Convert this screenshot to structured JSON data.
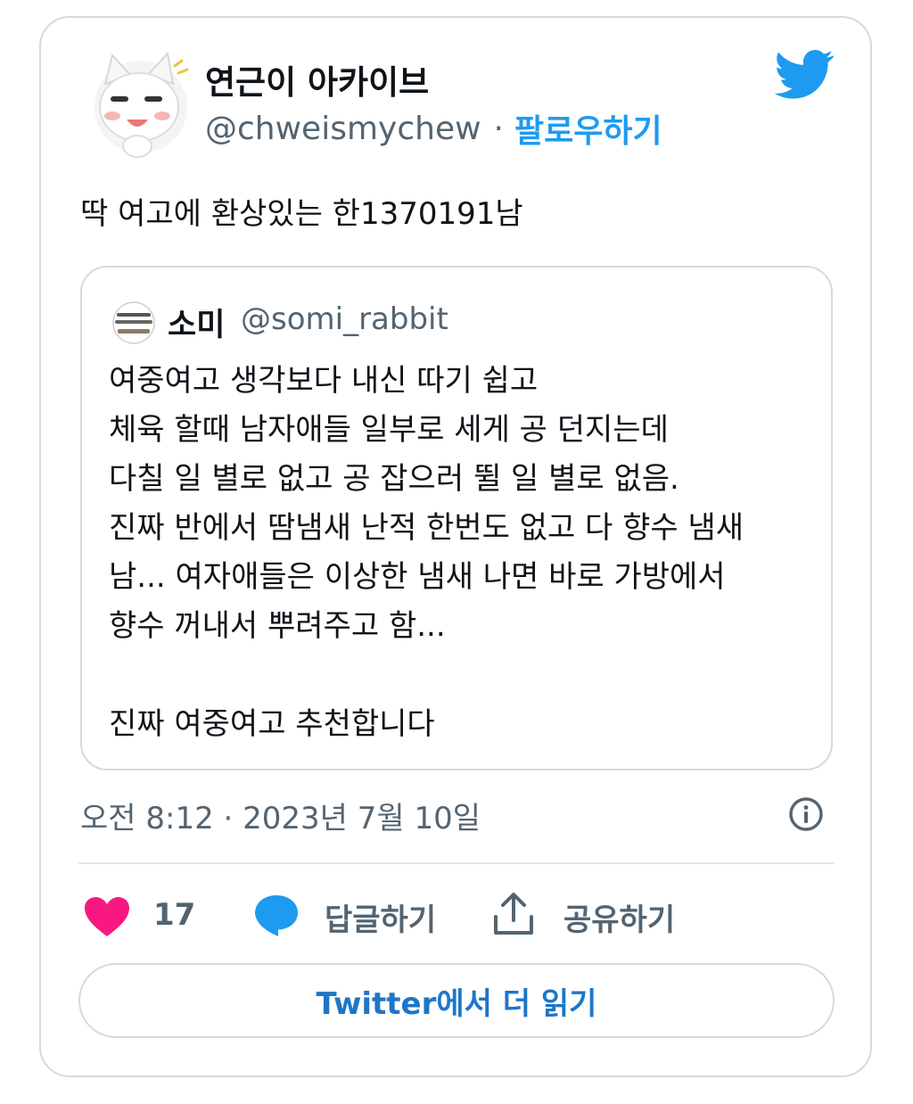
{
  "author": {
    "display_name": "연근이 아카이브",
    "handle": "@chweismychew",
    "separator": "·",
    "follow_label": "팔로우하기",
    "avatar_icon": "white-cat-avatar"
  },
  "brand": {
    "icon": "twitter-bird-icon",
    "color": "#1d9bf0"
  },
  "tweet": {
    "text": "딱 여고에 환상있는 한1370191남"
  },
  "quoted_tweet": {
    "display_name": "소미",
    "handle": "@somi_rabbit",
    "avatar_icon": "text-sign-avatar",
    "body": "여중여고 생각보다 내신 따기 쉽고\n체육 할때 남자애들 일부로 세게 공 던지는데\n다칠 일 별로 없고 공 잡으러 뛸 일 별로 없음.\n진짜 반에서 땀냄새 난적 한번도 없고 다 향수 냄새\n남... 여자애들은 이상한 냄새 나면 바로 가방에서\n향수 꺼내서 뿌려주고 함...\n\n진짜 여중여고 추천합니다"
  },
  "meta": {
    "timestamp": "오전 8:12 · 2023년 7월 10일",
    "info_icon": "info-icon"
  },
  "actions": {
    "like_count": "17",
    "like_color": "#f91880",
    "reply_label": "답글하기",
    "share_label": "공유하기"
  },
  "read_more_label": "Twitter에서 더 읽기"
}
